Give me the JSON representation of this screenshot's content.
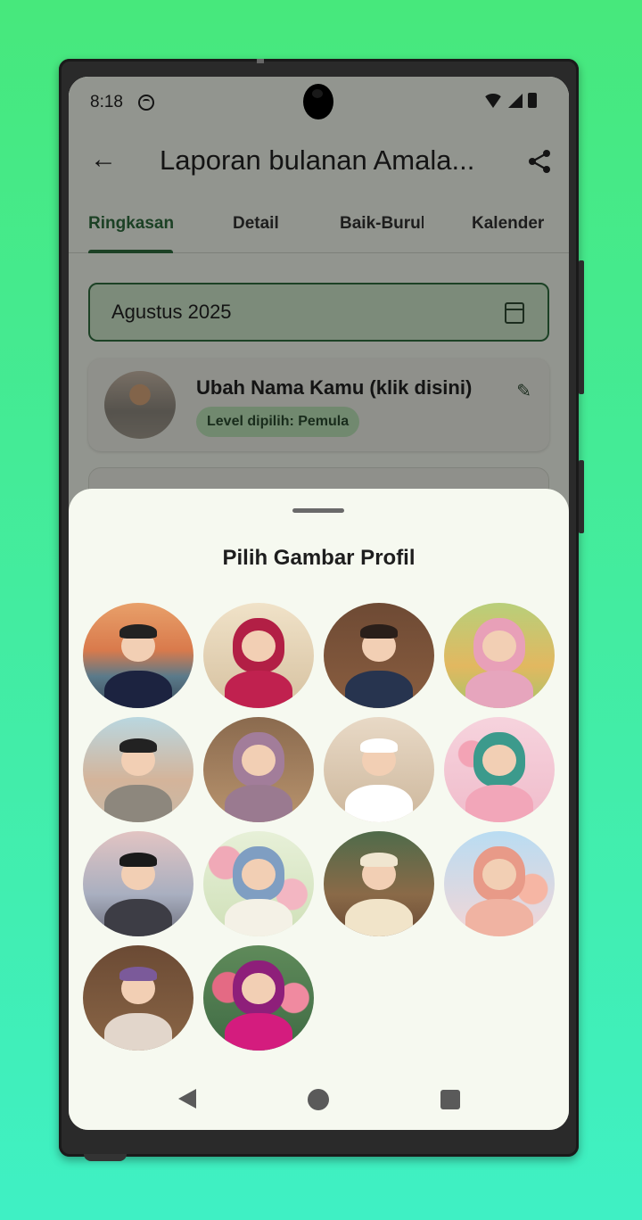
{
  "status": {
    "time": "8:18"
  },
  "appbar": {
    "title": "Laporan bulanan Amala..."
  },
  "tabs": [
    "Ringkasan",
    "Detail",
    "Baik-Buruk",
    "Kalender"
  ],
  "month": "Agustus 2025",
  "profile": {
    "name": "Ubah Nama Kamu (klik disini)",
    "level": "Level dipilih: Pemula"
  },
  "sheet": {
    "title": "Pilih Gambar Profil",
    "avatars": [
      "avatar-man-sunset",
      "avatar-woman-kitchen",
      "avatar-boy-library",
      "avatar-girl-park",
      "avatar-boy-street",
      "avatar-woman-cafe",
      "avatar-boy-kopiah",
      "avatar-girl-balloons-pink",
      "avatar-teen-pier",
      "avatar-girl-flowers-blue",
      "avatar-boy-market",
      "avatar-girl-balloons-peach",
      "avatar-grandpa-library",
      "avatar-woman-roses"
    ]
  },
  "colors": {
    "accent": "#2f6d3f",
    "chip": "#bde4b9",
    "sheet_bg": "#f6f9f0"
  }
}
